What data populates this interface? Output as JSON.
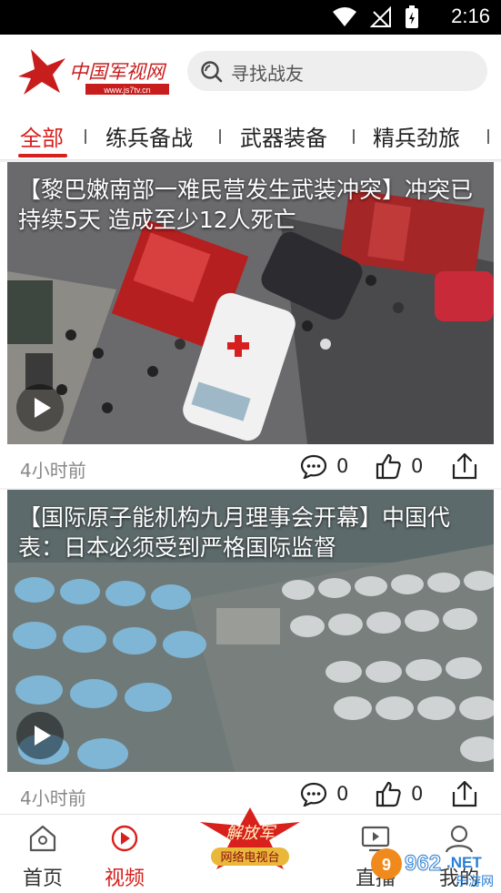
{
  "status_bar": {
    "time": "2:16"
  },
  "header": {
    "logo_text": "中国军视网",
    "logo_url": "www.js7tv.cn",
    "search_placeholder": "寻找战友"
  },
  "tabs": [
    "全部",
    "练兵备战",
    "武器装备",
    "精兵劲旅"
  ],
  "feed": [
    {
      "title": "【黎巴嫩南部一难民营发生武装冲突】冲突已持续5天 造成至少12人死亡",
      "time_ago": "4小时前",
      "comments": "0",
      "likes": "0"
    },
    {
      "title": "【国际原子能机构九月理事会开幕】中国代表：日本必须受到严格国际监督",
      "time_ago": "4小时前",
      "comments": "0",
      "likes": "0"
    }
  ],
  "bottom_nav": {
    "home": "首页",
    "video": "视频",
    "center_top": "解放军",
    "center_bottom": "网络电视台",
    "live": "直播",
    "profile": "我的"
  },
  "watermark": {
    "number": "962",
    "suffix": ".NET",
    "sub": "乐游网"
  },
  "colors": {
    "accent": "#d8201c"
  }
}
